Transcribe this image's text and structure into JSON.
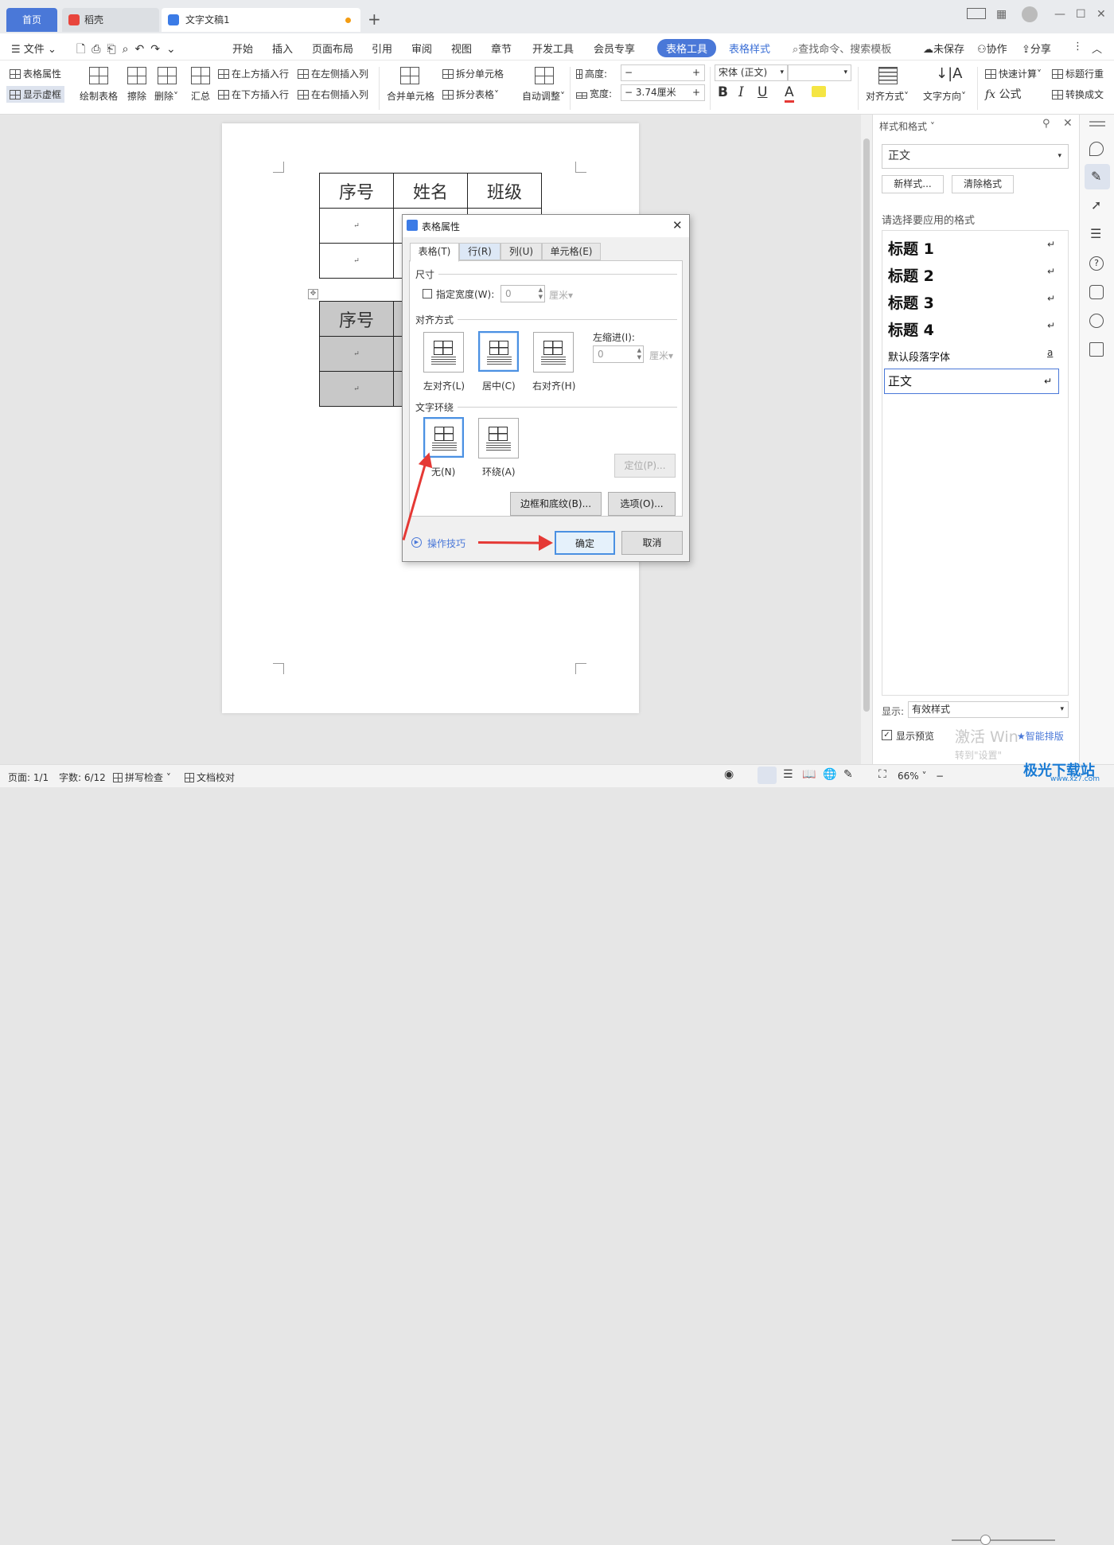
{
  "tabs": {
    "home": "首页",
    "daoke": "稻壳",
    "doc": "文字文稿1"
  },
  "menu": {
    "file": "文件",
    "items": [
      "开始",
      "插入",
      "页面布局",
      "引用",
      "审阅",
      "视图",
      "章节",
      "开发工具",
      "会员专享"
    ],
    "table_tools": "表格工具",
    "table_style": "表格样式",
    "search": "查找命令、搜索模板",
    "unsaved": "未保存",
    "collab": "协作",
    "share": "分享"
  },
  "ribbon": {
    "table_props": "表格属性",
    "show_grid": "显示虚框",
    "draw_table": "绘制表格",
    "erase": "擦除",
    "delete": "删除",
    "summary": "汇总",
    "insert_above": "在上方插入行",
    "insert_below": "在下方插入行",
    "insert_left": "在左侧插入列",
    "insert_right": "在右侧插入列",
    "merge": "合并单元格",
    "split_cell": "拆分单元格",
    "split_table": "拆分表格",
    "auto_adjust": "自动调整",
    "height_label": "高度:",
    "width_label": "宽度:",
    "width_value": "3.74厘米",
    "font": "宋体 (正文)",
    "bold": "B",
    "italic": "I",
    "underline": "U",
    "font_color": "A",
    "align": "对齐方式",
    "text_dir": "文字方向",
    "quick_calc": "快速计算",
    "formula": "公式",
    "header_row": "标题行重",
    "convert": "转换成文"
  },
  "document": {
    "table1_header": [
      "序号",
      "姓名",
      "班级"
    ],
    "table2_header": [
      "序号"
    ],
    "cell_mark": "↵"
  },
  "dialog": {
    "title": "表格属性",
    "tabs": [
      "表格(T)",
      "行(R)",
      "列(U)",
      "单元格(E)"
    ],
    "size_group": "尺寸",
    "specify_width": "指定宽度(W):",
    "width_value": "0",
    "unit": "厘米",
    "align_group": "对齐方式",
    "align_left": "左对齐(L)",
    "align_center": "居中(C)",
    "align_right": "右对齐(H)",
    "indent_label": "左缩进(I):",
    "indent_value": "0",
    "wrap_group": "文字环绕",
    "wrap_none": "无(N)",
    "wrap_around": "环绕(A)",
    "position": "定位(P)...",
    "borders": "边框和底纹(B)...",
    "options": "选项(O)...",
    "tips": "操作技巧",
    "ok": "确定",
    "cancel": "取消"
  },
  "panel": {
    "title": "样式和格式",
    "current_style": "正文",
    "new_style": "新样式...",
    "clear_format": "清除格式",
    "choose_prompt": "请选择要应用的格式",
    "styles": [
      "标题 1",
      "标题 2",
      "标题 3",
      "标题 4"
    ],
    "default_font": "默认段落字体",
    "default_font_mark": "a",
    "body": "正文",
    "show_label": "显示:",
    "show_value": "有效样式",
    "preview": "显示预览",
    "smart_layout": "智能排版",
    "watermark1": "激活 Win",
    "watermark2": "转到\"设置\""
  },
  "status": {
    "page": "页面: 1/1",
    "words": "字数: 6/12",
    "spell": "拼写检查",
    "proof": "文档校对",
    "zoom": "66%",
    "site": "极光下载站",
    "site_url": "www.xz7.com"
  },
  "colors": {
    "accent": "#4a78d8",
    "arrow": "#e53935",
    "selected_border": "#4a90e2"
  }
}
